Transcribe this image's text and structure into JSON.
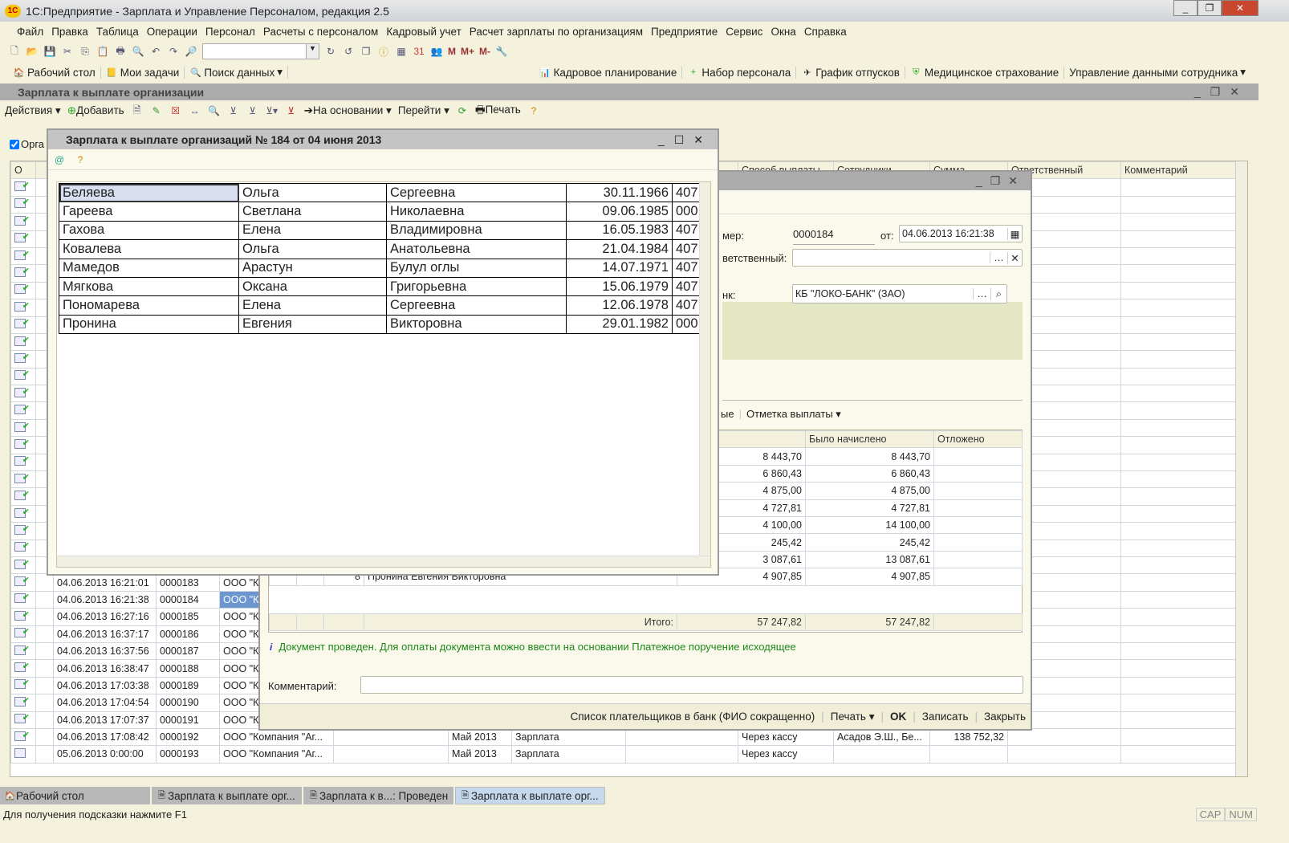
{
  "app": {
    "title": "1С:Предприятие - Зарплата и Управление Персоналом, редакция 2.5",
    "logo": "1С"
  },
  "menu": [
    "Файл",
    "Правка",
    "Таблица",
    "Операции",
    "Персонал",
    "Расчеты с персоналом",
    "Кадровый учет",
    "Расчет зарплаты по организациям",
    "Предприятие",
    "Сервис",
    "Окна",
    "Справка"
  ],
  "toolbar": {
    "mem_buttons": [
      "M",
      "M+",
      "M-"
    ],
    "search_value": ""
  },
  "panel": {
    "left": [
      "Рабочий стол",
      "Мои задачи",
      "Поиск данных"
    ],
    "right": [
      "Кадровое планирование",
      "Набор персонала",
      "График отпусков",
      "Медицинское страхование",
      "Управление данными сотрудника"
    ]
  },
  "list_window": {
    "title": "Зарплата к выплате организации",
    "actions": {
      "actions": "Действия",
      "add": "Добавить",
      "based_on": "На основании",
      "goto": "Перейти",
      "print": "Печать"
    },
    "org_filter": "Орга",
    "columns": [
      "О",
      "",
      "",
      "",
      "",
      "",
      "",
      "",
      "",
      "Способ выплаты",
      "Сотрудники",
      "Сумма",
      "Ответственный",
      "Комментарий"
    ],
    "rows": [
      {
        "date": "04.06.2013 16:21:01",
        "number": "0000183",
        "org": "ООО \"К",
        "period": "",
        "type": "",
        "method": "",
        "employees": "",
        "sum": ""
      },
      {
        "date": "04.06.2013 16:21:38",
        "number": "0000184",
        "org": "ООО \"К",
        "period": "",
        "type": "",
        "method": "",
        "employees": "",
        "sum": "",
        "selected": true
      },
      {
        "date": "04.06.2013 16:27:16",
        "number": "0000185",
        "org": "ООО \"К",
        "period": "",
        "type": "",
        "method": "",
        "employees": "",
        "sum": ""
      },
      {
        "date": "04.06.2013 16:37:17",
        "number": "0000186",
        "org": "ООО \"К",
        "period": "",
        "type": "",
        "method": "",
        "employees": "",
        "sum": ""
      },
      {
        "date": "04.06.2013 16:37:56",
        "number": "0000187",
        "org": "ООО \"К",
        "period": "",
        "type": "",
        "method": "",
        "employees": "",
        "sum": ""
      },
      {
        "date": "04.06.2013 16:38:47",
        "number": "0000188",
        "org": "ООО \"К",
        "period": "",
        "type": "",
        "method": "",
        "employees": "",
        "sum": ""
      },
      {
        "date": "04.06.2013 17:03:38",
        "number": "0000189",
        "org": "ООО \"К",
        "period": "",
        "type": "",
        "method": "",
        "employees": "",
        "sum": ""
      },
      {
        "date": "04.06.2013 17:04:54",
        "number": "0000190",
        "org": "ООО \"К",
        "period": "",
        "type": "",
        "method": "",
        "employees": "",
        "sum": ""
      },
      {
        "date": "04.06.2013 17:07:37",
        "number": "0000191",
        "org": "ООО \"К",
        "period": "",
        "type": "",
        "method": "",
        "employees": "",
        "sum": ""
      },
      {
        "date": "04.06.2013 17:08:42",
        "number": "0000192",
        "org": "ООО \"Компания \"Аг...",
        "period": "Май 2013",
        "type": "Зарплата",
        "method": "Через кассу",
        "employees": "Асадов Э.Ш., Бе...",
        "sum": "138 752,32"
      },
      {
        "date": "05.06.2013 0:00:00",
        "number": "0000193",
        "org": "ООО \"Компания \"Аг...",
        "period": "Май 2013",
        "type": "Зарплата",
        "method": "Через кассу",
        "employees": "",
        "sum": "",
        "unposted": true
      }
    ]
  },
  "doc_window": {
    "number_label": "мер:",
    "number": "0000184",
    "date_label": "от:",
    "date": "04.06.2013 16:21:38",
    "responsible_label": "ветственный:",
    "responsible": "",
    "bank_label": "нк:",
    "bank": "КБ \"ЛОКО-БАНК\" (ЗАО)",
    "table_toolbar": {
      "partial": "ые",
      "mark_payment": "Отметка выплаты"
    },
    "table_headers": [
      "Было начислено",
      "Отложено"
    ],
    "rows": [
      {
        "sum": "8 443,70",
        "accrued": "8 443,70"
      },
      {
        "sum": "6 860,43",
        "accrued": "6 860,43"
      },
      {
        "sum": "4 875,00",
        "accrued": "4 875,00"
      },
      {
        "sum": "4 727,81",
        "accrued": "4 727,81"
      },
      {
        "sum": "4 100,00",
        "accrued": "14 100,00"
      },
      {
        "sum": "245,42",
        "accrued": "245,42"
      },
      {
        "sum": "3 087,61",
        "accrued": "13 087,61"
      },
      {
        "sum": "4 907,85",
        "accrued": "4 907,85",
        "partial_name": "Пронина Евгения Викторовна",
        "partial_no": "8"
      }
    ],
    "total_label": "Итого:",
    "total_sum": "57 247,82",
    "total_accrued": "57 247,82",
    "info": "Документ проведен. Для оплаты документа можно ввести на основании Платежное поручение исходящее",
    "comment_label": "Комментарий:",
    "comment": "",
    "footer": {
      "payers_list": "Список плательщиков в банк (ФИО сокращенно)",
      "print": "Печать",
      "ok": "OK",
      "save": "Записать",
      "close": "Закрыть"
    }
  },
  "popup": {
    "title": "Зарплата к выплате организаций № 184 от 04 июня 2013",
    "rows": [
      [
        "Беляева",
        "Ольга",
        "Сергеевна",
        "30.11.1966",
        "407"
      ],
      [
        "Гареева",
        "Светлана",
        "Николаевна",
        "09.06.1985",
        "000"
      ],
      [
        "Гахова",
        "Елена",
        "Владимировна",
        "16.05.1983",
        "407"
      ],
      [
        "Ковалева",
        "Ольга",
        "Анатольевна",
        "21.04.1984",
        "407"
      ],
      [
        "Мамедов",
        "Арастун",
        "Булул оглы",
        "14.07.1971",
        "407"
      ],
      [
        "Мягкова",
        "Оксана",
        "Григорьевна",
        "15.06.1979",
        "407"
      ],
      [
        "Пономарева",
        "Елена",
        "Сергеевна",
        "12.06.1978",
        "407"
      ],
      [
        "Пронина",
        "Евгения",
        "Викторовна",
        "29.01.1982",
        "000"
      ]
    ]
  },
  "taskbar": [
    "Рабочий стол",
    "Зарплата к выплате орг...",
    "Зарплата к в...: Проведен",
    "Зарплата к выплате орг..."
  ],
  "status": {
    "hint": "Для получения подсказки нажмите F1",
    "cap": "CAP",
    "num": "NUM"
  }
}
